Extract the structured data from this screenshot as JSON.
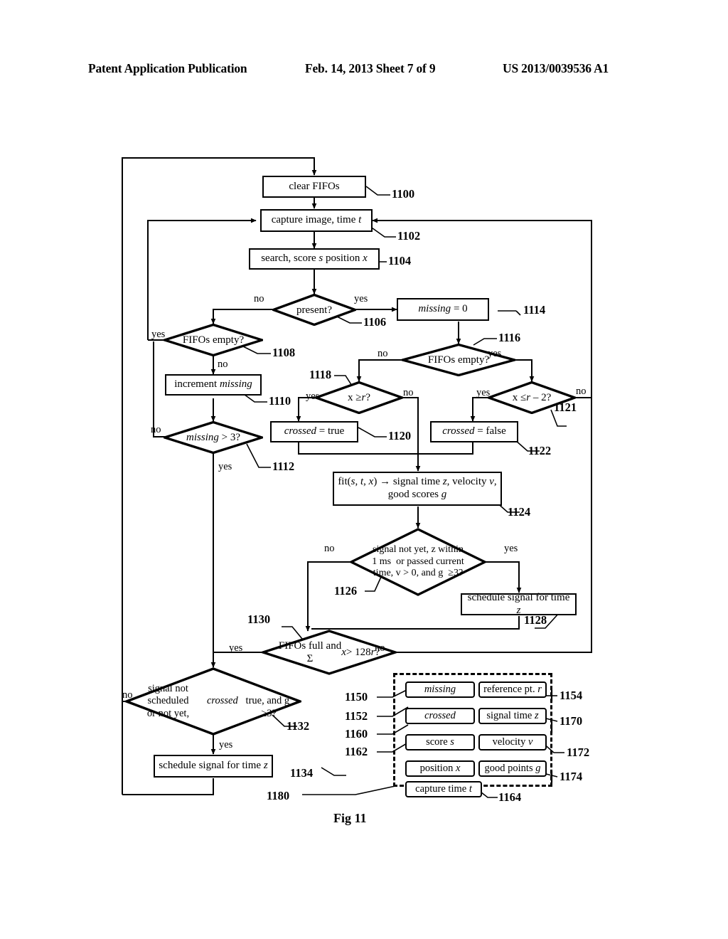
{
  "header": {
    "publication": "Patent Application Publication",
    "date_sheet": "Feb. 14, 2013  Sheet 7 of 9",
    "patent_number": "US 2013/0039536 A1"
  },
  "figure": {
    "caption": "Fig 11"
  },
  "nodes": {
    "n1100": {
      "label": "clear FIFOs",
      "ref": "1100",
      "type": "process"
    },
    "n1102": {
      "label": "capture image, time t",
      "ref": "1102",
      "type": "process"
    },
    "n1104": {
      "label": "search, score s position x",
      "ref": "1104",
      "type": "process"
    },
    "n1106": {
      "label": "present?",
      "ref": "1106",
      "type": "decision"
    },
    "n1108": {
      "label": "FIFOs empty?",
      "ref": "1108",
      "type": "decision"
    },
    "n1110": {
      "label": "increment missing",
      "ref": "1110",
      "type": "process"
    },
    "n1112": {
      "label": "missing > 3?",
      "ref": "1112",
      "type": "decision"
    },
    "n1114": {
      "label": "missing = 0",
      "ref": "1114",
      "type": "process"
    },
    "n1116": {
      "label": "FIFOs empty?",
      "ref": "1116",
      "type": "decision"
    },
    "n1118": {
      "label": "x ≥r?",
      "ref": "1118",
      "type": "decision"
    },
    "n1120": {
      "label": "crossed = true",
      "ref": "1120",
      "type": "process"
    },
    "n1121": {
      "label": "x ≤r – 2?",
      "ref": "1121",
      "type": "decision"
    },
    "n1122": {
      "label": "crossed = false",
      "ref": "1122",
      "type": "process"
    },
    "n1124": {
      "label": "fit(s, t, x) → signal time z, velocity v, good scores g",
      "ref": "1124",
      "type": "process"
    },
    "n1126": {
      "label": "signal not yet, z within 1 ms  or passed current time, v > 0, and g ≥3?",
      "ref": "1126",
      "type": "decision"
    },
    "n1128": {
      "label": "schedule signal for time z",
      "ref": "1128",
      "type": "process"
    },
    "n1130": {
      "label": "FIFOs full and Σx > 128r?",
      "ref": "1130",
      "type": "decision"
    },
    "n1132": {
      "label": "signal not scheduled or not yet, crossed true, and g ≥3?",
      "ref": "1132",
      "type": "decision"
    },
    "n1134": {
      "label": "schedule signal for time z",
      "ref": "1134",
      "type": "process"
    }
  },
  "edge_labels": {
    "e1106_no": "no",
    "e1106_yes": "yes",
    "e1108_yes": "yes",
    "e1108_no": "no",
    "e1112_no": "no",
    "e1112_yes": "yes",
    "e1116_no": "no",
    "e1116_yes": "yes",
    "e1118_yes": "yes",
    "e1118_no": "no",
    "e1121_yes": "yes",
    "e1121_no": "no",
    "e1126_no": "no",
    "e1126_yes": "yes",
    "e1130_yes": "yes",
    "e1130_no": "no",
    "e1132_no": "no",
    "e1132_yes": "yes"
  },
  "legend": {
    "ref_outer": "1180",
    "items": [
      {
        "label": "missing",
        "ref": "1150",
        "italic": true
      },
      {
        "label": "crossed",
        "ref": "1152",
        "italic": true
      },
      {
        "label": "score s",
        "ref": "1160",
        "italic": false
      },
      {
        "label": "position x",
        "ref": "1162",
        "italic": false
      },
      {
        "label": "capture time t",
        "ref": "1164",
        "italic": false
      },
      {
        "label": "reference pt. r",
        "ref": "1154",
        "italic": false
      },
      {
        "label": "signal time z",
        "ref": "1170",
        "italic": false
      },
      {
        "label": "velocity v",
        "ref": "1172",
        "italic": false
      },
      {
        "label": "good points g",
        "ref": "1174",
        "italic": false
      }
    ]
  },
  "colors": {
    "ink": "#000000",
    "paper": "#ffffff"
  }
}
